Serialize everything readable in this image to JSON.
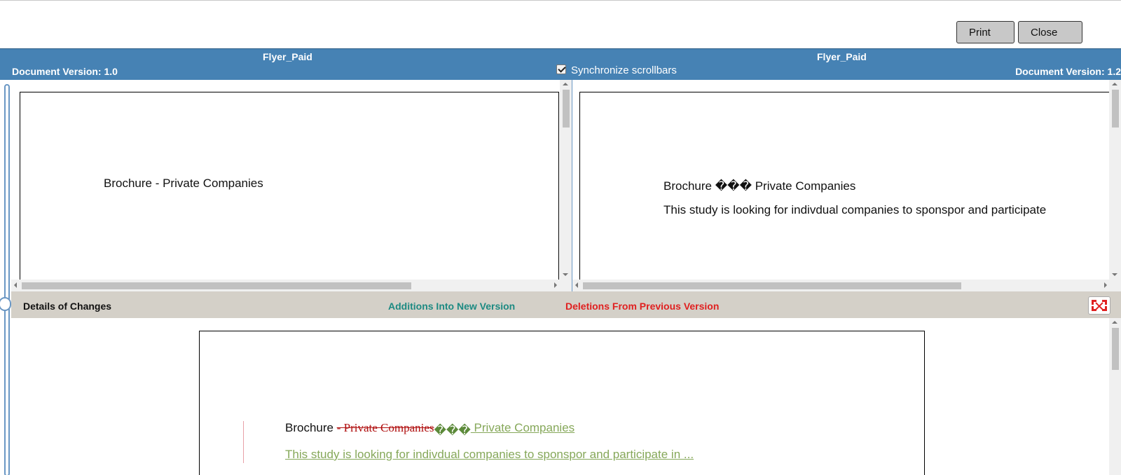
{
  "toolbar": {
    "print_label": "Print",
    "close_label": "Close"
  },
  "header": {
    "left_title": "Flyer_Paid",
    "right_title": "Flyer_Paid",
    "left_version": "Document Version: 1.0",
    "right_version": "Document Version: 1.2",
    "sync_label": "Synchronize scrollbars",
    "sync_checked": true
  },
  "left_pane": {
    "lines": [
      "Brochure - Private Companies"
    ]
  },
  "right_pane": {
    "lines": [
      "Brochure ��� Private Companies",
      "This study is looking for indivdual companies to sponspor and participate"
    ]
  },
  "details": {
    "label": "Details of Changes",
    "additions_label": "Additions Into New Version",
    "deletions_label": "Deletions From Previous Version",
    "colors": {
      "addition": "#1d8a82",
      "deletion": "#e02020"
    },
    "expand_icon": "expand-icon"
  },
  "compare": {
    "line1_prefix": "Brochure ",
    "line1_deleted": " - Private Companies",
    "line1_added_glyphs": "���",
    "line1_added": " Private Companies",
    "line2_added": "This study is looking for indivdual companies to sponspor and participate in ..."
  }
}
